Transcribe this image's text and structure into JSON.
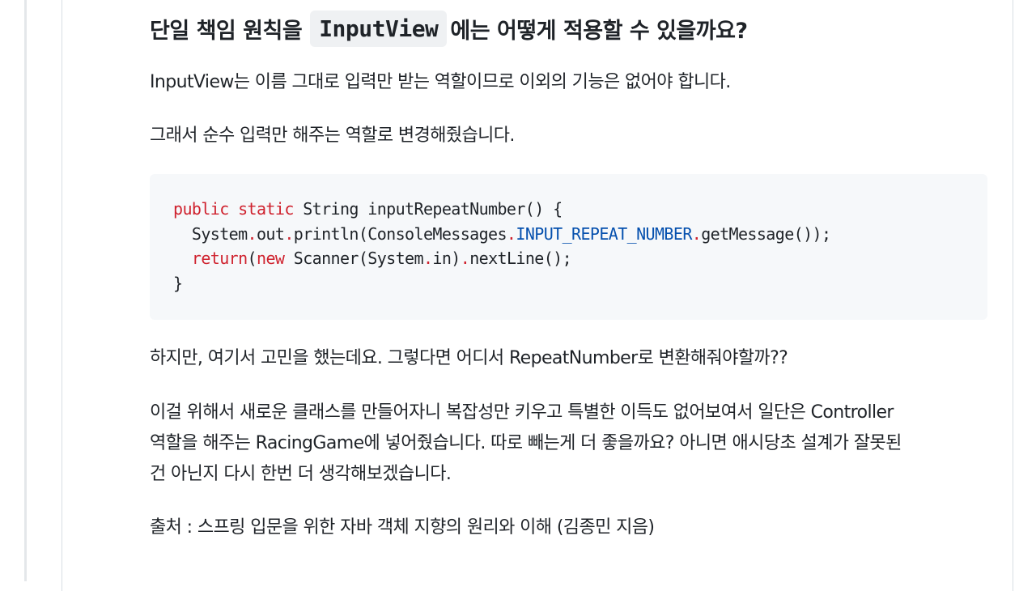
{
  "article": {
    "heading_prefix": "단일 책임 원칙을 ",
    "heading_code": "InputView",
    "heading_suffix": "에는 어떻게 적용할 수 있을까요?",
    "p1": "InputView는 이름 그대로 입력만 받는 역할이므로 이외의 기능은 없어야 합니다.",
    "p2": "그래서 순수 입력만 해주는 역할로 변경해줬습니다.",
    "p3": "하지만, 여기서 고민을 했는데요. 그렇다면 어디서 RepeatNumber로 변환해줘야할까??",
    "p4_line1": "이걸 위해서 새로운 클래스를 만들어자니 복잡성만 키우고 특별한 이득도 없어보여서 일단은 Controller",
    "p4_line2": "역할을 해주는 RacingGame에 넣어줬습니다. 따로 빼는게 더 좋을까요? 아니면 애시당초 설계가 잘못된",
    "p4_line3": "건 아닌지 다시 한번 더 생각해보겠습니다.",
    "p5": "출처 : 스프링 입문을 위한 자바 객체 지향의 원리와 이해 (김종민 지음)"
  },
  "code": {
    "l1_kw1": "public",
    "l1_kw2": "static",
    "l1_rest": " String inputRepeatNumber() {",
    "l2_indent": "  System",
    "l2_dot1": ".",
    "l2_a": "out",
    "l2_dot2": ".",
    "l2_b": "println(ConsoleMessages",
    "l2_dot3": ".",
    "l2_const": "INPUT_REPEAT_NUMBER",
    "l2_dot4": ".",
    "l2_c": "getMessage());",
    "l3_kw1": "return",
    "l3_a": "(",
    "l3_kw2": "new",
    "l3_b": " Scanner(System",
    "l3_dot1": ".",
    "l3_c": "in)",
    "l3_dot2": ".",
    "l3_d": "nextLine();",
    "l4": "}"
  },
  "colors": {
    "keyword": "#cf222e",
    "constant": "#0550ae",
    "code_background": "#f6f8fa"
  }
}
